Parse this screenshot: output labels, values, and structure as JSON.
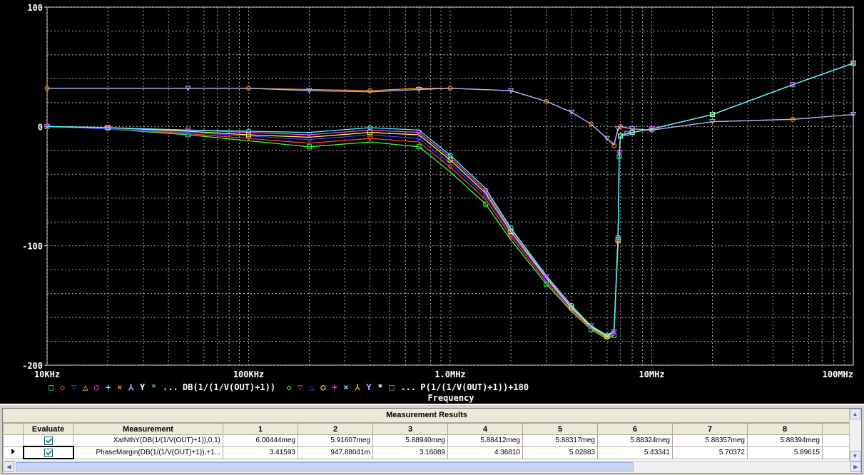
{
  "chart_data": {
    "type": "line",
    "x_scale": "log",
    "xlim": [
      10000,
      100000000
    ],
    "ylim": [
      -200,
      100
    ],
    "x_ticks": [
      {
        "value": 10000,
        "label": "10KHz"
      },
      {
        "value": 100000,
        "label": "100KHz"
      },
      {
        "value": 1000000,
        "label": "1.0MHz"
      },
      {
        "value": 10000000,
        "label": "10MHz"
      },
      {
        "value": 100000000,
        "label": "100MHz"
      }
    ],
    "y_ticks": [
      {
        "value": 100,
        "label": "100"
      },
      {
        "value": 0,
        "label": "0"
      },
      {
        "value": -100,
        "label": "-100"
      },
      {
        "value": -200,
        "label": "-200"
      }
    ],
    "xlabel": "Frequency",
    "grid": true,
    "background": "#000000",
    "legend": [
      {
        "text": "DB(1/(1/V(OUT)+1))",
        "markers": "□◇▽△○+×⅄Y*",
        "ellipsis": "..."
      },
      {
        "text": "P(1/(1/V(OUT)+1))+180",
        "markers": "◇▽△○+×⅄Y*□",
        "ellipsis": "..."
      }
    ],
    "series_colors": [
      "#39ff39",
      "#ff4040",
      "#3c3cff",
      "#ffff40",
      "#ff40ff",
      "#40ffff",
      "#ff8c1a",
      "#b0b0ff",
      "#ffffff",
      "#40c080"
    ],
    "series": [
      {
        "group": "DB(1/(1/V(OUT)+1))",
        "x": [
          10000,
          20000,
          50000,
          100000,
          200000,
          400000,
          700000,
          1000000,
          1500000,
          2000000,
          3000000,
          4000000,
          5000000,
          6000000,
          6500000,
          6800000,
          6900000,
          7000000,
          7500000,
          8000000,
          10000000,
          20000000,
          50000000,
          100000000
        ],
        "curves": [
          {
            "dy": [
              0,
              -2,
              -7,
              -12,
              -17,
              -13,
              -17,
              -38,
              -65,
              -95,
              -132,
              -155,
              -170,
              -178,
              -175,
              -100,
              -25,
              -8,
              -6,
              -5,
              -2,
              10,
              35,
              53
            ]
          },
          {
            "dy": [
              0,
              -2,
              -6,
              -10,
              -14,
              -10,
              -13,
              -34,
              -61,
              -92,
              -130,
              -154,
              -169,
              -177,
              -174,
              -98,
              -24,
              -8,
              -6,
              -5,
              -2,
              10,
              35,
              53
            ]
          },
          {
            "dy": [
              0,
              -2,
              -5,
              -8,
              -11,
              -7,
              -10,
              -31,
              -58,
              -90,
              -128,
              -153,
              -168,
              -176,
              -173,
              -96,
              -23,
              -8,
              -6,
              -5,
              -2,
              10,
              35,
              53
            ]
          },
          {
            "dy": [
              0,
              -1,
              -4,
              -7,
              -9,
              -5,
              -7,
              -28,
              -56,
              -88,
              -127,
              -152,
              -168,
              -176,
              -172,
              -95,
              -22,
              -8,
              -6,
              -5,
              -2,
              10,
              35,
              53
            ]
          },
          {
            "dy": [
              0,
              -1,
              -3,
              -5,
              -7,
              -3,
              -5,
              -26,
              -54,
              -86,
              -126,
              -151,
              -167,
              -175,
              -172,
              -94,
              -22,
              -8,
              -6,
              -5,
              -2,
              10,
              35,
              53
            ]
          },
          {
            "dy": [
              0,
              -1,
              -3,
              -4,
              -5,
              -1,
              -3,
              -24,
              -52,
              -85,
              -125,
              -150,
              -167,
              -175,
              -171,
              -93,
              -21,
              -8,
              -6,
              -5,
              -2,
              10,
              35,
              53
            ]
          }
        ]
      },
      {
        "group": "P(1/(1/V(OUT)+1))+180",
        "x": [
          10000,
          50000,
          100000,
          200000,
          400000,
          700000,
          1000000,
          2000000,
          3000000,
          4000000,
          5000000,
          6000000,
          6500000,
          6800000,
          7000000,
          8000000,
          10000000,
          20000000,
          50000000,
          100000000
        ],
        "curves": [
          {
            "dy": [
              32,
              32,
              32,
              31,
              30,
              32,
              32,
              30,
              21,
              12,
              2,
              -10,
              -16,
              -2,
              0,
              -2,
              -3,
              4,
              6,
              10
            ]
          },
          {
            "dy": [
              32,
              32,
              32,
              30,
              29,
              31,
              32,
              30,
              21,
              12,
              2,
              -10,
              -15,
              -2,
              0,
              -2,
              -3,
              4,
              6,
              10
            ]
          }
        ]
      }
    ]
  },
  "results": {
    "title": "Measurement Results",
    "headers": {
      "evaluate": "Evaluate",
      "measurement": "Measurement",
      "cols": [
        "1",
        "2",
        "3",
        "4",
        "5",
        "6",
        "7",
        "8"
      ]
    },
    "rows": [
      {
        "measurement": "XatNthY(DB(1/(1/V(OUT)+1)),0,1)",
        "values": [
          "6.00444meg",
          "5.91607meg",
          "5.88940meg",
          "5.88412meg",
          "5.88317meg",
          "5.88324meg",
          "5.88357meg",
          "5.88394meg"
        ]
      },
      {
        "measurement": "PhaseMargin(DB(1/(1/V(OUT)+1)),+1...",
        "values": [
          "3.41593",
          "947.88041m",
          "3.16089",
          "4.36810",
          "5.02883",
          "5.43341",
          "5.70372",
          "5.89615"
        ]
      }
    ]
  }
}
